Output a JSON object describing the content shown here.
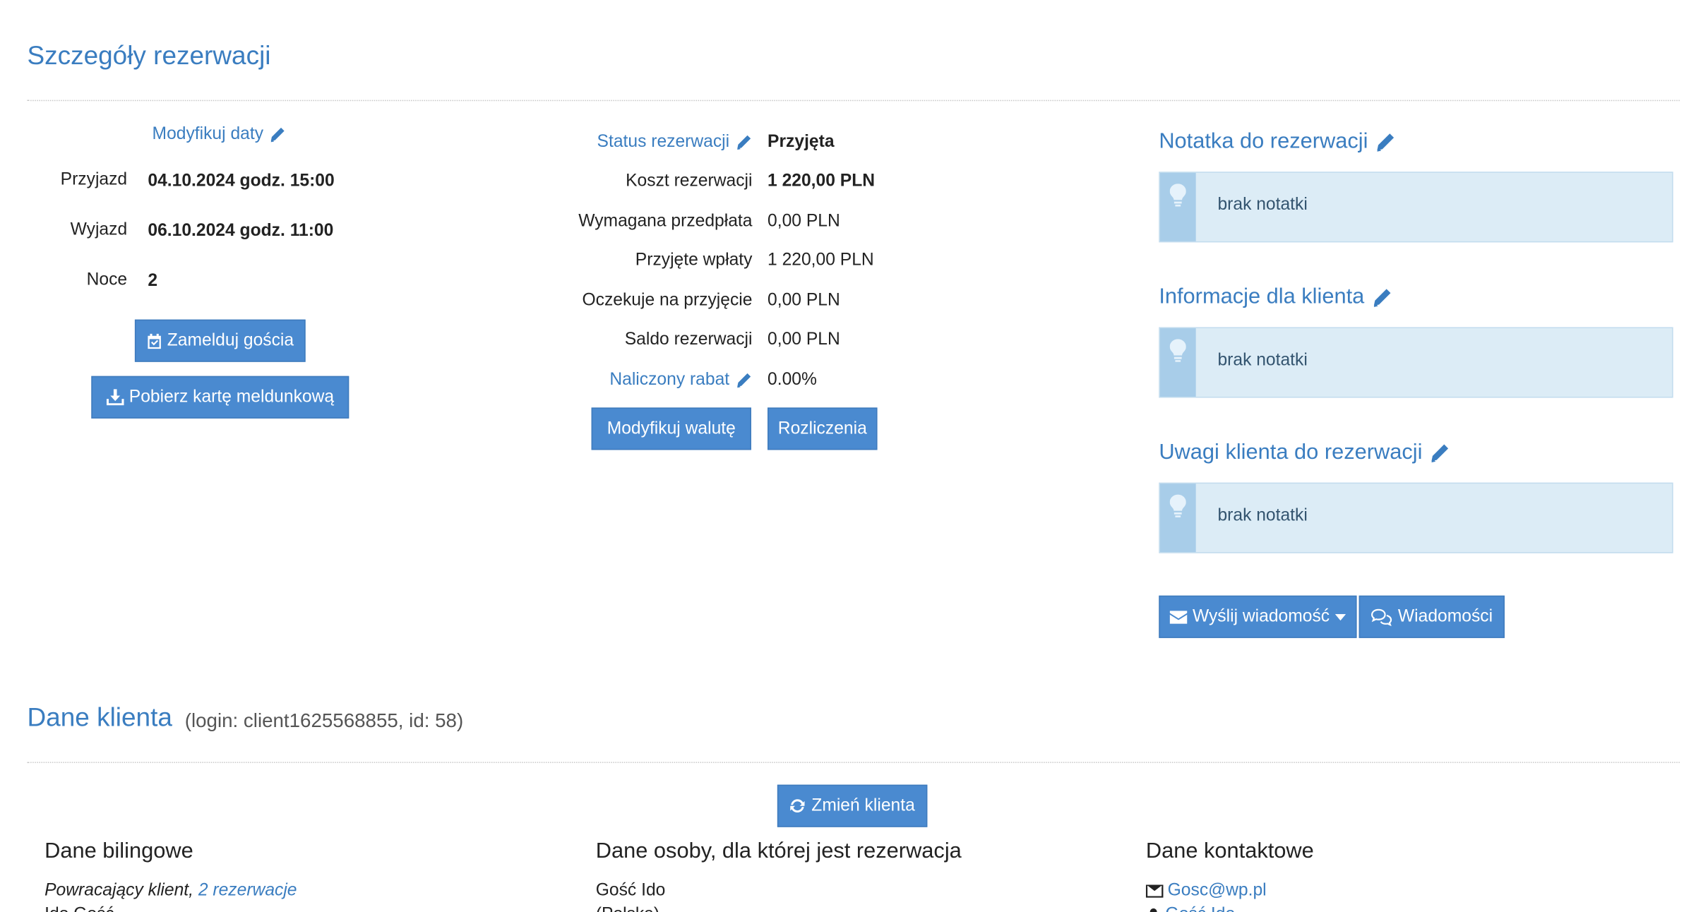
{
  "reservation": {
    "title": "Szczegóły rezerwacji",
    "modify_dates": "Modyfikuj daty",
    "arrival_label": "Przyjazd",
    "arrival_value": "04.10.2024 godz. 15:00",
    "departure_label": "Wyjazd",
    "departure_value": "06.10.2024 godz. 11:00",
    "nights_label": "Noce",
    "nights_value": "2",
    "checkin_button": "Zamelduj gościa",
    "download_card_button": "Pobierz kartę meldunkową"
  },
  "finance": {
    "status_label": "Status rezerwacji",
    "status_value": "Przyjęta",
    "cost_label": "Koszt rezerwacji",
    "cost_value": "1 220,00 PLN",
    "prepayment_label": "Wymagana przedpłata",
    "prepayment_value": "0,00 PLN",
    "received_label": "Przyjęte wpłaty",
    "received_value": "1 220,00 PLN",
    "pending_label": "Oczekuje na przyjęcie",
    "pending_value": "0,00 PLN",
    "balance_label": "Saldo rezerwacji",
    "balance_value": "0,00 PLN",
    "discount_label": "Naliczony rabat",
    "discount_value": "0.00%",
    "modify_currency_button": "Modyfikuj walutę",
    "settlements_button": "Rozliczenia"
  },
  "notes": {
    "reservation_note_title": "Notatka do rezerwacji",
    "reservation_note_text": "brak notatki",
    "client_info_title": "Informacje dla klienta",
    "client_info_text": "brak notatki",
    "client_remarks_title": "Uwagi klienta do rezerwacji",
    "client_remarks_text": "brak notatki",
    "send_message_button": "Wyślij wiadomość",
    "messages_button": "Wiadomości"
  },
  "client": {
    "title": "Dane klienta",
    "subtitle": "(login: client1625568855, id: 58)",
    "change_client_button": "Zmień klienta",
    "billing_title": "Dane bilingowe",
    "returning_client": "Powracający klient,",
    "reservations_link": "2 rezerwacje",
    "billing_name": "Ido Gość",
    "guest_title": "Dane osoby, dla której jest rezerwacja",
    "guest_name": "Gość Ido",
    "guest_country": "(Polska)",
    "contact_title": "Dane kontaktowe",
    "contact_email": "Gosc@wp.pl",
    "contact_name": "Gość Ido"
  },
  "colors": {
    "accent": "#3a7dc0",
    "button": "#4a8ad0",
    "note_bg": "#dcecf6",
    "note_side": "#a8cde9"
  }
}
